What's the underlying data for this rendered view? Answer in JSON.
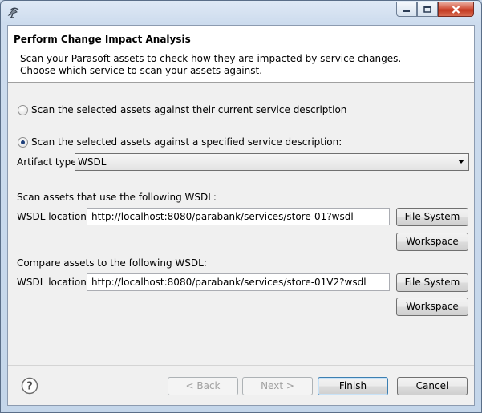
{
  "window": {
    "title": ""
  },
  "dialog": {
    "title": "Perform Change Impact Analysis",
    "description": "Scan your Parasoft assets to check how they are impacted by service changes.  Choose which service to scan your assets against."
  },
  "options": {
    "current_label": "Scan the selected assets against their current service description",
    "specified_label": "Scan the selected assets against a specified service description:",
    "selected": "specified"
  },
  "artifact": {
    "label": "Artifact type:",
    "value": "WSDL"
  },
  "scan_section": {
    "heading": "Scan assets that use the following WSDL:",
    "location_label": "WSDL location:",
    "location_value": "http://localhost:8080/parabank/services/store-01?wsdl",
    "file_system_button": "File System",
    "workspace_button": "Workspace"
  },
  "compare_section": {
    "heading": "Compare assets to the following WSDL:",
    "location_label": "WSDL location:",
    "location_value": "http://localhost:8080/parabank/services/store-01V2?wsdl",
    "file_system_button": "File System",
    "workspace_button": "Workspace"
  },
  "footer": {
    "back": "< Back",
    "next": "Next >",
    "finish": "Finish",
    "cancel": "Cancel",
    "help_glyph": "?"
  },
  "icons": {
    "window_icon": "satellite-dish-icon",
    "minimize": "minimize-icon",
    "maximize": "maximize-icon",
    "close": "close-icon",
    "help": "help-icon",
    "dropdown": "chevron-down-icon"
  },
  "colors": {
    "frame": "#c4d6ea",
    "close_button": "#c2371f",
    "default_button_border": "#3c7fb1",
    "dialog_bg": "#f0f0f0"
  }
}
